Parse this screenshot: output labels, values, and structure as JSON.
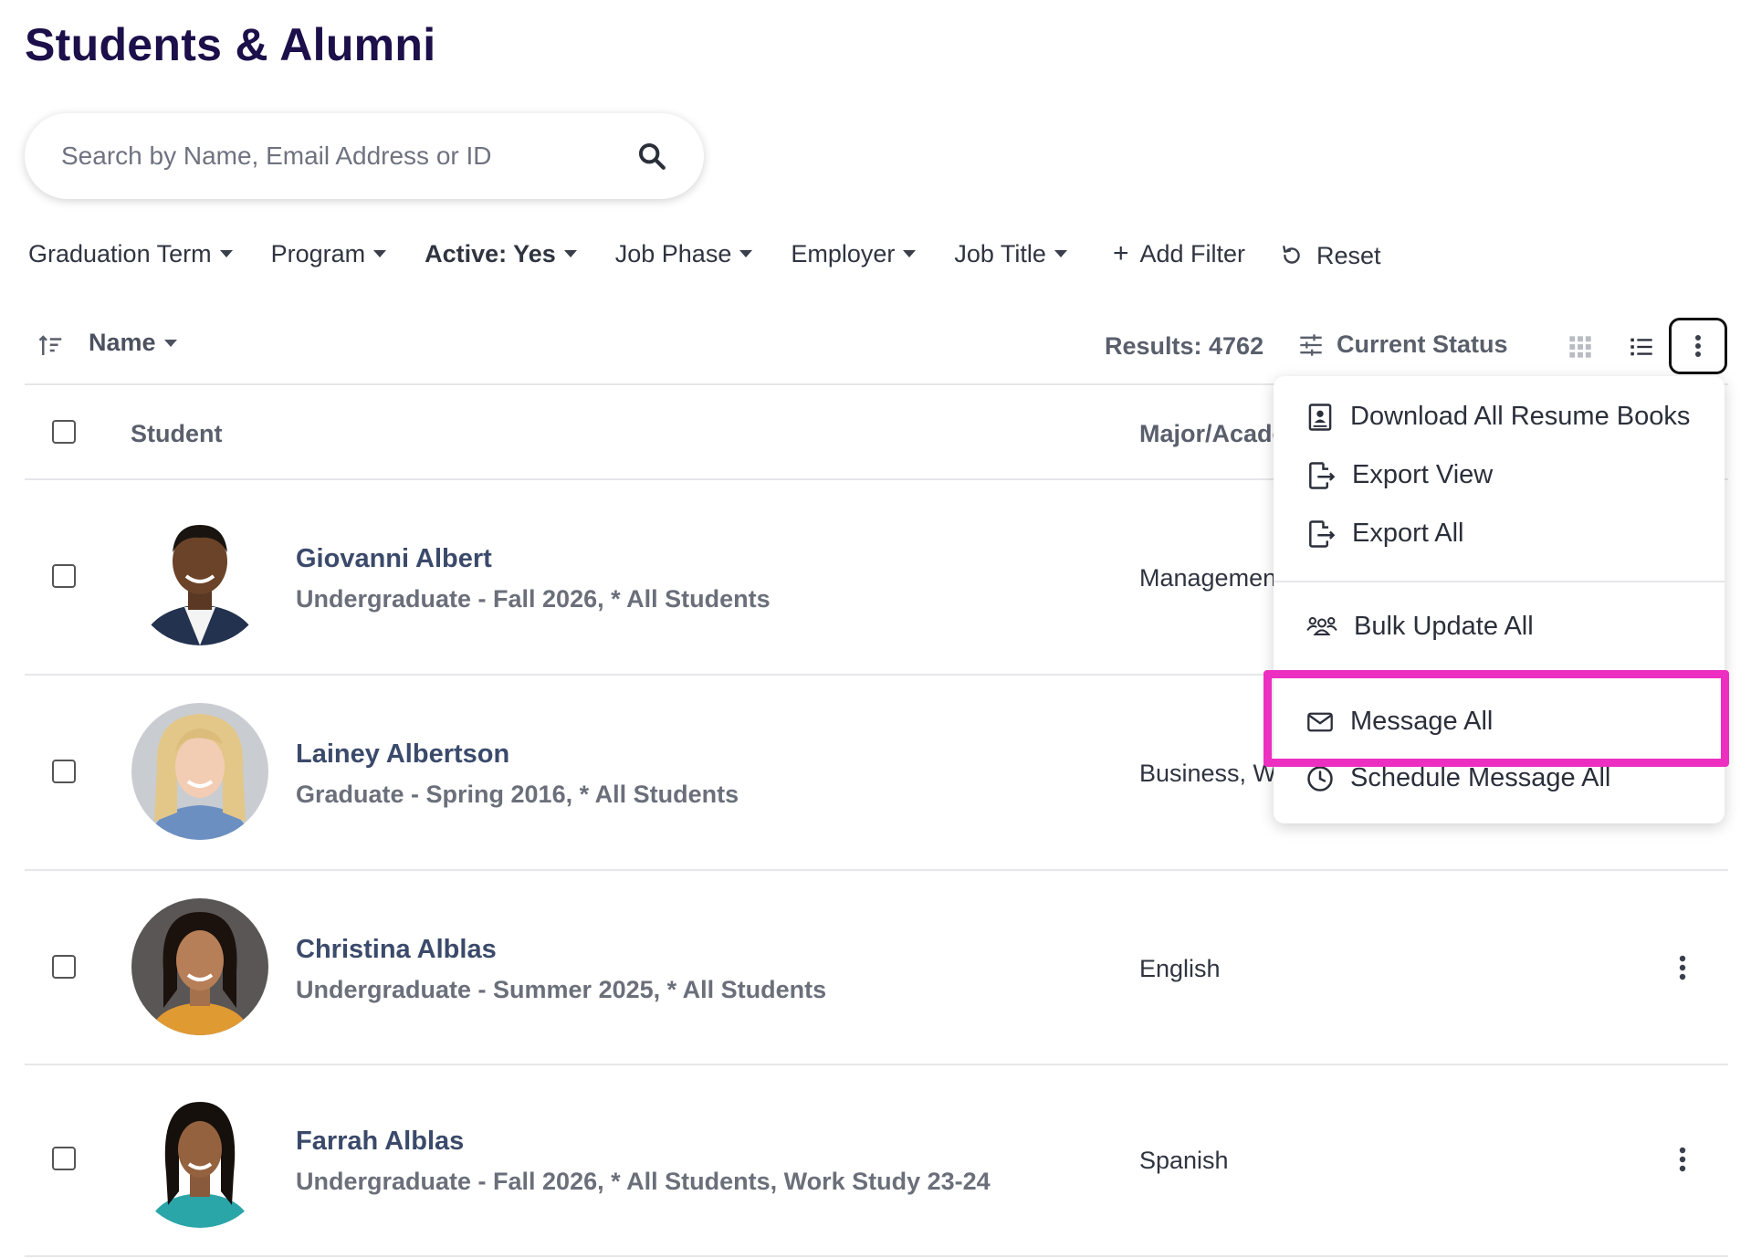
{
  "page": {
    "title": "Students & Alumni"
  },
  "search": {
    "placeholder": "Search by Name, Email Address or ID"
  },
  "filters": [
    {
      "label": "Graduation Term"
    },
    {
      "label": "Program"
    },
    {
      "label": "Active: Yes"
    },
    {
      "label": "Job Phase"
    },
    {
      "label": "Employer"
    },
    {
      "label": "Job Title"
    }
  ],
  "add_filter": "Add Filter",
  "reset": "Reset",
  "toolbar": {
    "sort_label": "Name",
    "results": "Results: 4762",
    "status_label": "Current Status"
  },
  "table": {
    "col_student": "Student",
    "col_major": "Major/Acade"
  },
  "rows": [
    {
      "name": "Giovanni Albert",
      "sub": "Undergraduate - Fall 2026, * All Students",
      "major": "Managemen"
    },
    {
      "name": "Lainey Albertson",
      "sub": "Graduate - Spring 2016, * All Students",
      "major": "Business, Wo"
    },
    {
      "name": "Christina Alblas",
      "sub": "Undergraduate - Summer 2025, * All Students",
      "major": "English"
    },
    {
      "name": "Farrah Alblas",
      "sub": "Undergraduate - Fall 2026, * All Students, Work Study 23-24",
      "major": "Spanish"
    }
  ],
  "menu": {
    "download_resume_books": "Download All Resume Books",
    "export_view": "Export View",
    "export_all": "Export All",
    "bulk_update_all": "Bulk Update All",
    "message_all": "Message All",
    "schedule_message_all": "Schedule Message All"
  },
  "colors": {
    "title": "#1c0f4a",
    "highlight": "#ec2ec1",
    "name_link": "#3b4a6b"
  },
  "icons": [
    "search-icon",
    "caret-down-icon",
    "plus-icon",
    "reset-icon",
    "sort-icon",
    "sliders-icon",
    "grid-view-icon",
    "list-view-icon",
    "kebab-icon",
    "resume-book-icon",
    "export-icon",
    "users-icon",
    "envelope-icon",
    "clock-icon"
  ]
}
